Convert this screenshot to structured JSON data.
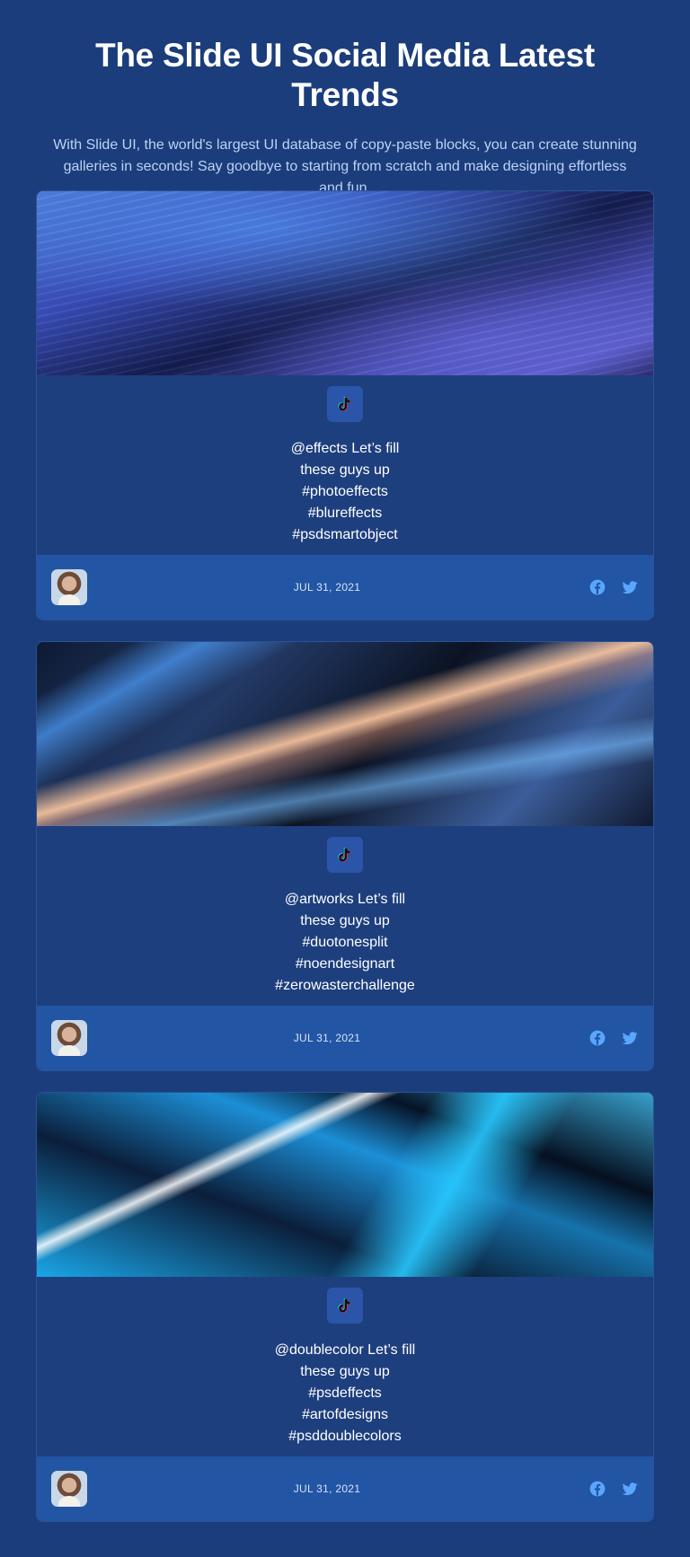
{
  "header": {
    "title": "The Slide UI Social Media Latest Trends",
    "subtitle": "With Slide UI, the world's largest UI database of copy-paste blocks, you can create stunning galleries in seconds! Say goodbye to starting from scratch and make designing effortless and fun."
  },
  "colors": {
    "background": "#1b3d7b",
    "card_footer": "#2255a4",
    "social_icon": "#5aa6ff"
  },
  "cards": [
    {
      "image_icon": "abstract-purple-waves-image",
      "platform_icon": "tiktok-icon",
      "lines": [
        "@effects Let’s fill",
        "these guys up",
        "#photoeffects",
        "#blureffects",
        "#psdsmartobject"
      ],
      "date": "JUL 31, 2021"
    },
    {
      "image_icon": "abstract-metallic-streaks-image",
      "platform_icon": "tiktok-icon",
      "lines": [
        "@artworks Let’s fill",
        "these guys up",
        "#duotonesplit",
        "#noendesignart",
        "#zerowasterchallenge"
      ],
      "date": "JUL 31, 2021"
    },
    {
      "image_icon": "abstract-blue-glass-shards-image",
      "platform_icon": "tiktok-icon",
      "lines": [
        "@doublecolor Let’s fill",
        "these guys up",
        "#psdeffects",
        "#artofdesigns",
        "#psddoublecolors"
      ],
      "date": "JUL 31, 2021"
    }
  ]
}
